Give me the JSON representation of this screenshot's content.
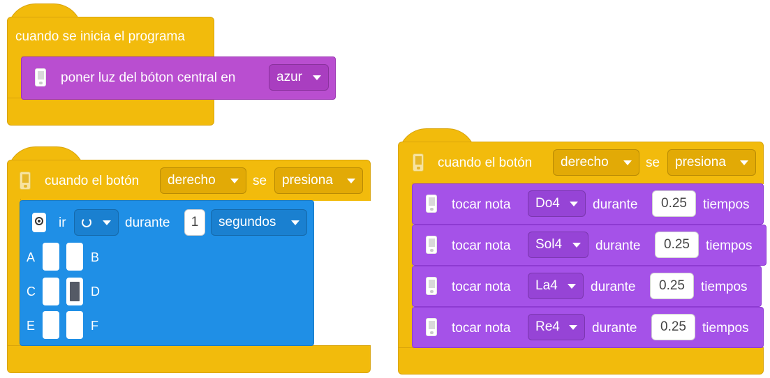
{
  "blocks": {
    "start": {
      "label": "cuando se inicia el programa",
      "action": {
        "label": "poner luz del bóton central en",
        "color_value": "azur"
      }
    },
    "button_left": {
      "label_prefix": "cuando el botón",
      "button_value": "derecho",
      "label_middle": "se",
      "event_value": "presiona",
      "motor": {
        "label_prefix": "ir",
        "direction_icon": "rotate-clockwise-icon",
        "label_middle": "durante",
        "amount": "1",
        "unit_value": "segundos",
        "ports": [
          {
            "left": "A",
            "right": "B"
          },
          {
            "left": "C",
            "right": "D"
          },
          {
            "left": "E",
            "right": "F"
          }
        ]
      }
    },
    "button_right": {
      "label_prefix": "cuando el botón",
      "button_value": "derecho",
      "label_middle": "se",
      "event_value": "presiona",
      "notes": [
        {
          "label": "tocar nota",
          "note": "Do4",
          "during": "durante",
          "beats": "0.25",
          "unit": "tiempos"
        },
        {
          "label": "tocar nota",
          "note": "Sol4",
          "during": "durante",
          "beats": "0.25",
          "unit": "tiempos"
        },
        {
          "label": "tocar nota",
          "note": "La4",
          "during": "durante",
          "beats": "0.25",
          "unit": "tiempos"
        },
        {
          "label": "tocar nota",
          "note": "Re4",
          "during": "durante",
          "beats": "0.25",
          "unit": "tiempos"
        }
      ]
    }
  },
  "colors": {
    "event_yellow": "#f2bb0c",
    "light_purple": "#b94ed0",
    "sound_purple": "#a552e8",
    "motor_blue": "#1f8fe6"
  }
}
